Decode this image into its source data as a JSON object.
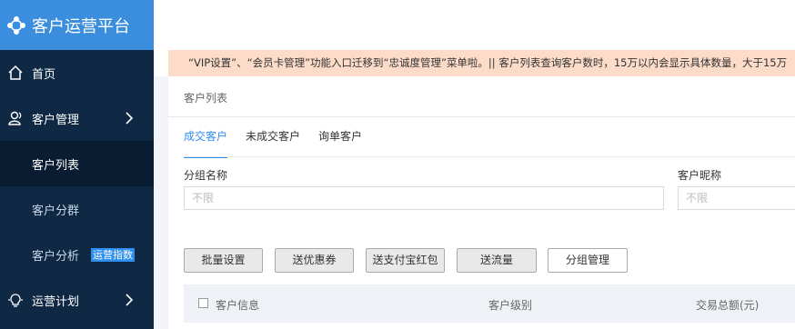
{
  "brand": {
    "title": "客户运营平台"
  },
  "sidebar": {
    "items": [
      {
        "label": "首页",
        "icon": "home-icon"
      },
      {
        "label": "客户管理",
        "icon": "user-icon"
      },
      {
        "label": "运营计划",
        "icon": "lightbulb-icon"
      }
    ],
    "subitems": [
      {
        "label": "客户列表"
      },
      {
        "label": "客户分群"
      },
      {
        "label": "客户分析",
        "badge": "运营指数"
      }
    ]
  },
  "notice": {
    "text": "“VIP设置”、“会员卡管理”功能入口迁移到“忠诚度管理”菜单啦。|| 客户列表查询客户数时，15万以内会显示具体数量，大于15万"
  },
  "page": {
    "breadcrumb": "客户列表"
  },
  "tabs": [
    {
      "label": "成交客户"
    },
    {
      "label": "未成交客户"
    },
    {
      "label": "询单客户"
    }
  ],
  "filters": {
    "group_name": {
      "label": "分组名称",
      "placeholder": "不限"
    },
    "nickname": {
      "label": "客户昵称",
      "placeholder": "不限"
    }
  },
  "actions": {
    "batch": "批量设置",
    "coupon": "送优惠券",
    "alipay": "送支付宝红包",
    "traffic": "送流量",
    "group_manage": "分组管理"
  },
  "table": {
    "headers": [
      "客户信息",
      "客户级别",
      "交易总额(元)"
    ]
  },
  "colors": {
    "brand": "#3b8ede",
    "sidebar": "#0f2945",
    "accent": "#2f8fef",
    "notice": "#fcdcc8"
  }
}
